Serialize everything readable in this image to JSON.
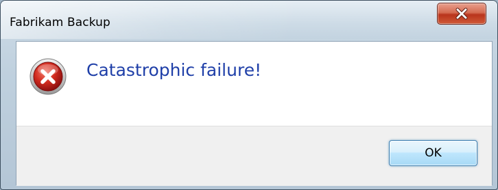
{
  "window": {
    "title": "Fabrikam Backup",
    "close_icon": "close-icon"
  },
  "dialog": {
    "icon": "error-icon",
    "message": "Catastrophic failure!",
    "ok_label": "OK"
  },
  "colors": {
    "message_text": "#1f3fa8",
    "close_button": "#c9452b",
    "error_icon": "#cc1f1f",
    "footer_background": "#f0f0f0"
  }
}
